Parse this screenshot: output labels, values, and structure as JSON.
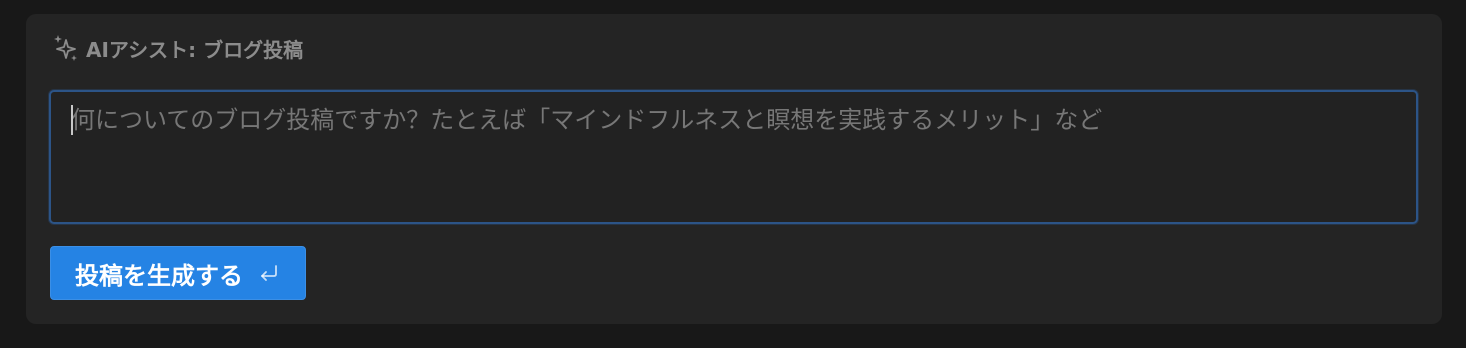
{
  "header": {
    "icon": "sparkle-icon",
    "title": "AIアシスト: ブログ投稿"
  },
  "prompt": {
    "value": "",
    "placeholder": "何についてのブログ投稿ですか？たとえば「マインドフルネスと瞑想を実践するメリット」など"
  },
  "generate_button": {
    "label": "投稿を生成する",
    "icon": "enter-icon"
  },
  "colors": {
    "background": "#181818",
    "panel": "#242424",
    "input_border": "#2c5487",
    "button": "#2583e4"
  }
}
